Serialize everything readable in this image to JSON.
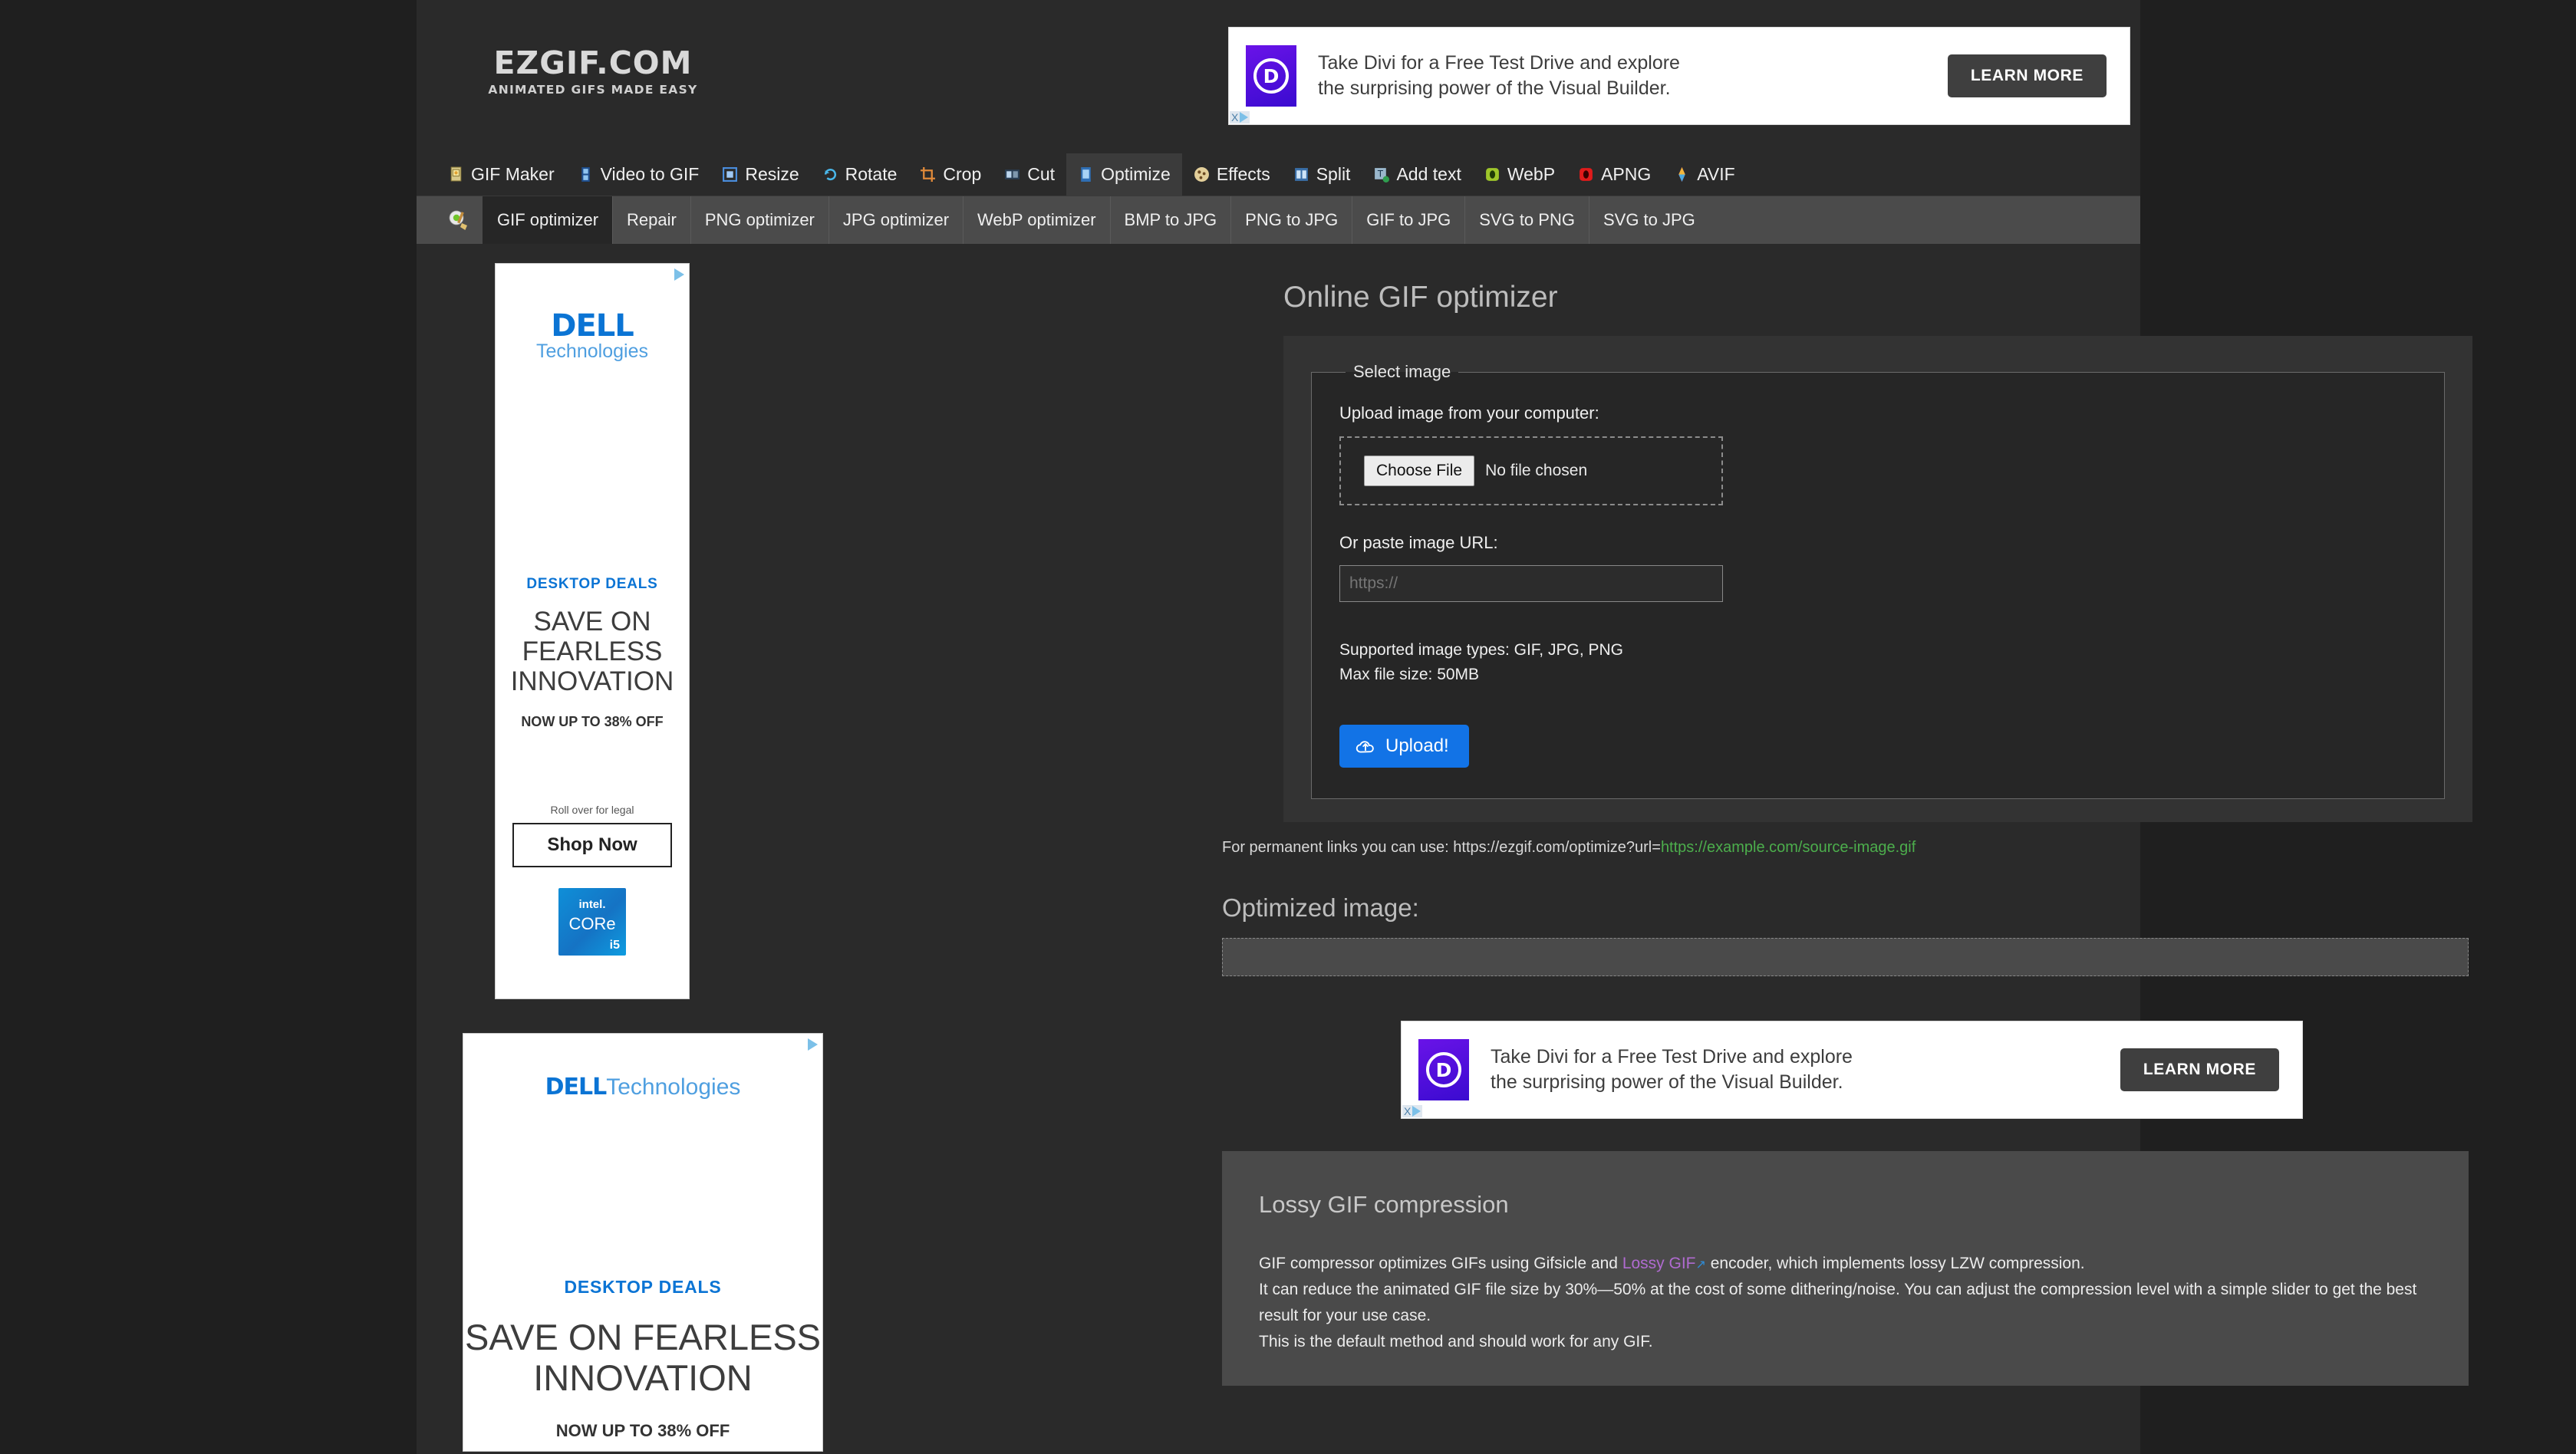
{
  "site": {
    "logo_main": "EZGIF.COM",
    "logo_sub": "ANIMATED GIFS MADE EASY"
  },
  "colors": {
    "page_bg": "#2a2a2a",
    "outer_bg": "#1f1f1f",
    "accent_blue": "#1273e6",
    "link_green": "#4cae4c",
    "link_purple": "#b06bd0",
    "dell_blue": "#0b74d4"
  },
  "top_ad": {
    "brand_letter": "D",
    "line1": "Take Divi for a Free Test Drive and explore",
    "line2": "the surprising power of the Visual Builder.",
    "cta": "LEARN MORE",
    "close_mark": "X"
  },
  "mid_ad": {
    "brand_letter": "D",
    "line1": "Take Divi for a Free Test Drive and explore",
    "line2": "the surprising power of the Visual Builder.",
    "cta": "LEARN MORE",
    "close_mark": "X"
  },
  "mainnav": {
    "items": [
      {
        "label": "GIF Maker",
        "icon": "gif-maker-icon",
        "active": false
      },
      {
        "label": "Video to GIF",
        "icon": "video-to-gif-icon",
        "active": false
      },
      {
        "label": "Resize",
        "icon": "resize-icon",
        "active": false
      },
      {
        "label": "Rotate",
        "icon": "rotate-icon",
        "active": false
      },
      {
        "label": "Crop",
        "icon": "crop-icon",
        "active": false
      },
      {
        "label": "Cut",
        "icon": "cut-icon",
        "active": false
      },
      {
        "label": "Optimize",
        "icon": "optimize-icon",
        "active": true
      },
      {
        "label": "Effects",
        "icon": "effects-icon",
        "active": false
      },
      {
        "label": "Split",
        "icon": "split-icon",
        "active": false
      },
      {
        "label": "Add text",
        "icon": "add-text-icon",
        "active": false
      },
      {
        "label": "WebP",
        "icon": "webp-icon",
        "active": false
      },
      {
        "label": "APNG",
        "icon": "apng-icon",
        "active": false
      },
      {
        "label": "AVIF",
        "icon": "avif-icon",
        "active": false
      }
    ]
  },
  "subnav": {
    "icon": "optimize-broom-icon",
    "items": [
      {
        "label": "GIF optimizer",
        "active": true
      },
      {
        "label": "Repair",
        "active": false
      },
      {
        "label": "PNG optimizer",
        "active": false
      },
      {
        "label": "JPG optimizer",
        "active": false
      },
      {
        "label": "WebP optimizer",
        "active": false
      },
      {
        "label": "BMP to JPG",
        "active": false
      },
      {
        "label": "PNG to JPG",
        "active": false
      },
      {
        "label": "GIF to JPG",
        "active": false
      },
      {
        "label": "SVG to PNG",
        "active": false
      },
      {
        "label": "SVG to JPG",
        "active": false
      }
    ]
  },
  "main": {
    "page_title": "Online GIF optimizer",
    "fieldset_legend": "Select image",
    "upload_label": "Upload image from your computer:",
    "choose_file_button": "Choose File",
    "no_file_text": "No file chosen",
    "url_label": "Or paste image URL:",
    "url_placeholder": "https://",
    "url_value": "",
    "supported_types": "Supported image types: GIF, JPG, PNG",
    "max_file_size": "Max file size: 50MB",
    "upload_button": "Upload!",
    "permalink_prefix": "For permanent links you can use: https://ezgif.com/optimize?url=",
    "permalink_example": "https://example.com/source-image.gif",
    "optimized_heading": "Optimized image:"
  },
  "info": {
    "heading": "Lossy GIF compression",
    "p1_before": "GIF compressor optimizes GIFs using Gifsicle and ",
    "p1_link": "Lossy GIF",
    "p1_after": " encoder, which implements lossy LZW compression.",
    "p2": "It can reduce the animated GIF file size by 30%—50% at the cost of some dithering/noise. You can adjust the compression level with a simple slider to get the best result for your use case.",
    "p3": "This is the default method and should work for any GIF."
  },
  "side_ad_1": {
    "brand": "DELL",
    "brand_sub": "Technologies",
    "deals": "DESKTOP DEALS",
    "head1": "SAVE ON",
    "head2": "FEARLESS",
    "head3": "INNOVATION",
    "off": "NOW UP TO 38% OFF",
    "rollover": "Roll over for legal",
    "cta": "Shop Now",
    "chip_brand": "intel.",
    "chip_line": "CORe",
    "chip_model": "i5"
  },
  "side_ad_2": {
    "brand": "DELL",
    "brand_sub": "Technologies",
    "deals": "DESKTOP DEALS",
    "head1": "SAVE ON FEARLESS",
    "head2": "INNOVATION",
    "off": "NOW UP TO 38% OFF"
  }
}
